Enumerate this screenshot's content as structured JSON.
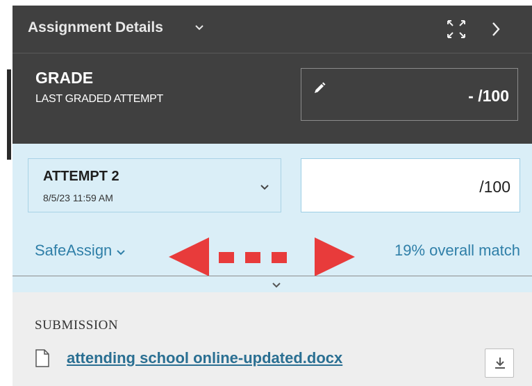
{
  "header": {
    "title": "Assignment Details",
    "icons": {
      "dropdown": "chevron-down-icon",
      "expand": "expand-icon",
      "next": "chevron-right-icon"
    }
  },
  "grade": {
    "title": "GRADE",
    "subtitle": "LAST GRADED ATTEMPT",
    "value": "- /100",
    "icon": "pencil-icon"
  },
  "attempt": {
    "label": "ATTEMPT 2",
    "date": "8/5/23 11:59 AM",
    "score": "/100"
  },
  "safeassign": {
    "label": "SafeAssign",
    "match": "19% overall match"
  },
  "submission": {
    "label": "SUBMISSION",
    "file_name": "attending school online-updated.docx",
    "icons": {
      "file": "file-icon",
      "download": "download-icon"
    }
  },
  "colors": {
    "header_bg": "#404040",
    "attempt_bg": "#daeef7",
    "link": "#2f7fa8",
    "annotation": "#e83b3b",
    "submission_bg": "#eeeeee"
  }
}
